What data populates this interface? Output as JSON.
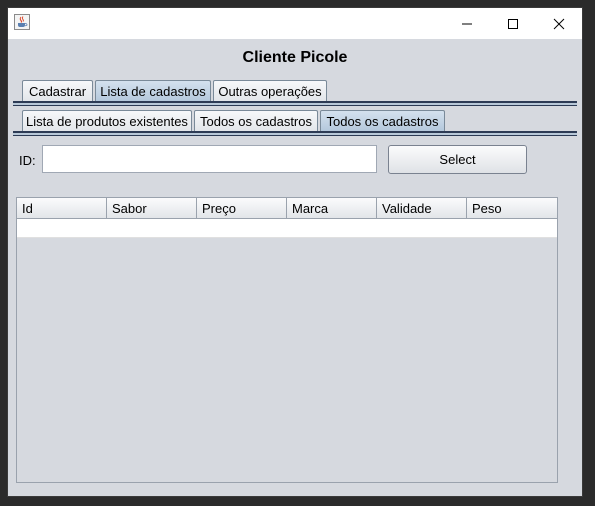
{
  "window": {
    "controls": {
      "minimize": "minimize-icon",
      "maximize": "maximize-icon",
      "close": "close-icon"
    },
    "app_icon": "java-cup-icon"
  },
  "app_title": "Cliente Picole",
  "tabs_main": [
    {
      "label": "Cadastrar",
      "selected": false
    },
    {
      "label": "Lista de cadastros",
      "selected": true
    },
    {
      "label": "Outras operações",
      "selected": false
    }
  ],
  "tabs_sub": [
    {
      "label": "Lista de produtos existentes",
      "selected": false
    },
    {
      "label": "Todos os cadastros",
      "selected": false
    },
    {
      "label": "Todos os cadastros",
      "selected": true
    }
  ],
  "form": {
    "id_label": "ID:",
    "id_value": "",
    "select_label": "Select"
  },
  "table": {
    "columns": [
      "Id",
      "Sabor",
      "Preço",
      "Marca",
      "Validade",
      "Peso"
    ],
    "rows": []
  },
  "colors": {
    "window_bg": "#d6d9df",
    "tab_selected": "#b4c8dc",
    "tab_line": "#2d3b55"
  }
}
